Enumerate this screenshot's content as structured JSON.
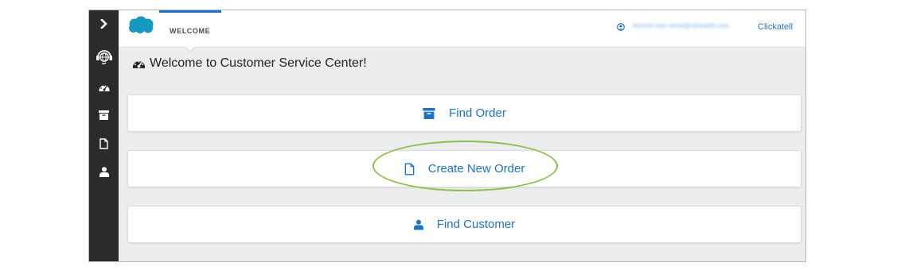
{
  "sidebar": {
    "items": [
      {
        "icon": "chevron-right-icon"
      },
      {
        "icon": "headset-globe-icon"
      },
      {
        "icon": "dashboard-icon"
      },
      {
        "icon": "archive-icon"
      },
      {
        "icon": "file-icon"
      },
      {
        "icon": "user-icon"
      }
    ]
  },
  "header": {
    "logo_icon": "salesforce-cloud-icon",
    "tab_label": "WELCOME",
    "user_email": "blurred-user-email@clickatell.com",
    "org_label": "Clickatell"
  },
  "main": {
    "welcome_text": "Welcome to Customer Service Center!",
    "actions": [
      {
        "label": "Find Order",
        "icon": "archive-icon"
      },
      {
        "label": "Create New Order",
        "icon": "file-icon",
        "highlighted": true
      },
      {
        "label": "Find Customer",
        "icon": "user-icon"
      }
    ]
  },
  "colors": {
    "sidebar_bg": "#2b2b2b",
    "accent": "#1d72c6",
    "brand_cloud": "#1798c1",
    "highlight_ring": "#8dc04a",
    "content_bg": "#ecedef"
  }
}
